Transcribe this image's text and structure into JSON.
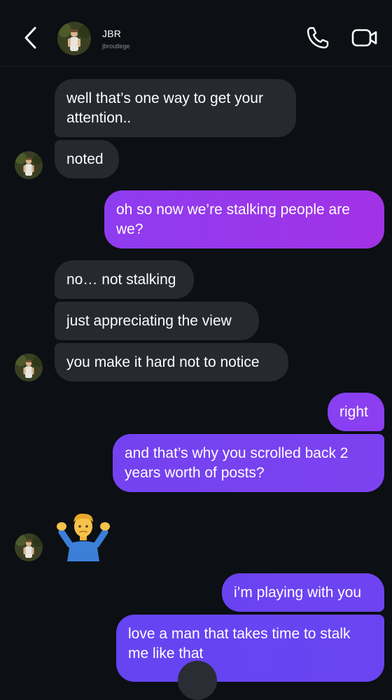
{
  "header": {
    "name": "JBR",
    "handle": "jbroutlege"
  },
  "colors": {
    "background": "#0c0f14",
    "incoming_bubble": "#262930",
    "outgoing_bubble_start": "#6a45f0",
    "outgoing_bubble_end": "#a132e6"
  },
  "messages": [
    {
      "from": "them",
      "text": "well that’s one way to get your attention.."
    },
    {
      "from": "them",
      "text": "noted"
    },
    {
      "from": "me",
      "text": "oh so now we’re stalking people are we?"
    },
    {
      "from": "them",
      "text": "no… not stalking"
    },
    {
      "from": "them",
      "text": "just appreciating the view"
    },
    {
      "from": "them",
      "text": "you make it hard not to notice"
    },
    {
      "from": "me",
      "text": "right"
    },
    {
      "from": "me",
      "text": "and that’s why you scrolled back 2 years worth of posts?"
    },
    {
      "from": "them",
      "text": "🤷‍♂️",
      "type": "emoji",
      "icon": "man-shrugging-emoji"
    },
    {
      "from": "me",
      "text": "i’m playing with you"
    },
    {
      "from": "me",
      "text": "love a man that takes time to stalk me like that"
    }
  ]
}
